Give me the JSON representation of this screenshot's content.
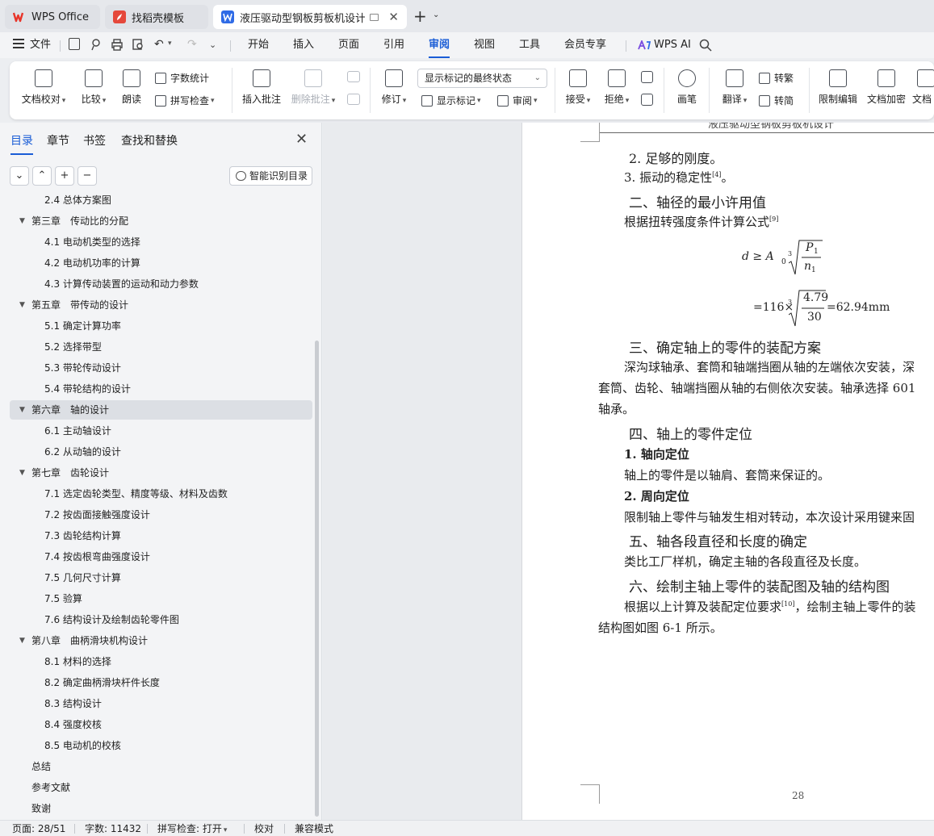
{
  "tabs": [
    {
      "label": "WPS Office",
      "active": false
    },
    {
      "label": "找稻壳模板",
      "active": false
    },
    {
      "label": "液压驱动型钢板剪板机设计 说",
      "active": true
    }
  ],
  "menu": {
    "file": "文件",
    "items": [
      "开始",
      "插入",
      "页面",
      "引用",
      "审阅",
      "视图",
      "工具",
      "会员专享"
    ],
    "active": "审阅",
    "ai": "WPS AI"
  },
  "ribbon": {
    "doc_proof": "文档校对",
    "compare": "比较",
    "read_aloud": "朗读",
    "word_count": "字数统计",
    "spell_check": "拼写检查",
    "insert_comment": "插入批注",
    "delete_comment": "删除批注",
    "revise": "修订",
    "markup_state": "显示标记的最终状态",
    "show_markup": "显示标记",
    "review": "审阅",
    "accept": "接受",
    "reject": "拒绝",
    "pen": "画笔",
    "translate": "翻译",
    "to_traditional": "转繁",
    "to_simplified": "转简",
    "restrict_edit": "限制编辑",
    "encrypt": "文档加密",
    "doc_more": "文档"
  },
  "nav": {
    "tabs": [
      "目录",
      "章节",
      "书签",
      "查找和替换"
    ],
    "active_tab": "目录",
    "smart_toc": "智能识别目录",
    "items": [
      {
        "text": "2.4 总体方案图",
        "level": 2
      },
      {
        "text": "第三章　传动比的分配",
        "level": 1,
        "expanded": true
      },
      {
        "text": "4.1 电动机类型的选择",
        "level": 2
      },
      {
        "text": "4.2 电动机功率的计算",
        "level": 2
      },
      {
        "text": "4.3 计算传动装置的运动和动力参数",
        "level": 2
      },
      {
        "text": "第五章　带传动的设计",
        "level": 1,
        "expanded": true
      },
      {
        "text": "5.1 确定计算功率",
        "level": 2
      },
      {
        "text": "5.2 选择带型",
        "level": 2
      },
      {
        "text": "5.3 带轮传动设计",
        "level": 2
      },
      {
        "text": "5.4 带轮结构的设计",
        "level": 2
      },
      {
        "text": "第六章　轴的设计",
        "level": 1,
        "expanded": true,
        "selected": true
      },
      {
        "text": "6.1 主动轴设计",
        "level": 2
      },
      {
        "text": "6.2 从动轴的设计",
        "level": 2
      },
      {
        "text": "第七章　齿轮设计",
        "level": 1,
        "expanded": true
      },
      {
        "text": "7.1 选定齿轮类型、精度等级、材料及齿数",
        "level": 2
      },
      {
        "text": "7.2 按齿面接触强度设计",
        "level": 2
      },
      {
        "text": "7.3 齿轮结构计算",
        "level": 2
      },
      {
        "text": "7.4 按齿根弯曲强度设计",
        "level": 2
      },
      {
        "text": "7.5 几何尺寸计算",
        "level": 2
      },
      {
        "text": "7.5 验算",
        "level": 2
      },
      {
        "text": "7.6 结构设计及绘制齿轮零件图",
        "level": 2
      },
      {
        "text": "第八章　曲柄滑块机构设计",
        "level": 1,
        "expanded": true
      },
      {
        "text": "8.1 材料的选择",
        "level": 2
      },
      {
        "text": "8.2 确定曲柄滑块杆件长度",
        "level": 2
      },
      {
        "text": "8.3 结构设计",
        "level": 2
      },
      {
        "text": "8.4 强度校核",
        "level": 2
      },
      {
        "text": "8.5 电动机的校核",
        "level": 2
      },
      {
        "text": "总结",
        "level": 1,
        "expanded": false
      },
      {
        "text": "参考文献",
        "level": 1,
        "expanded": false
      },
      {
        "text": "致谢",
        "level": 1,
        "expanded": false
      }
    ]
  },
  "doc": {
    "running_header": "液压驱动型钢板剪板机设计",
    "l1": "2. 足够的刚度。",
    "l2": "3. 振动的稳定性",
    "l2_ref": "[4]",
    "l2_end": "。",
    "h2": "二、轴径的最小许用值",
    "l3": "根据扭转强度条件计算公式",
    "l3_ref": "[9]",
    "formula1_lhs": "d ≥ A",
    "formula1_sub": "0",
    "formula1_num": "P",
    "formula1_num_sub": "1",
    "formula1_den": "n",
    "formula1_den_sub": "1",
    "formula2_lhs": "=116×",
    "formula2_num": "4.79",
    "formula2_den": "30",
    "formula2_rhs": "=62.94mm",
    "h3": "三、确定轴上的零件的装配方案",
    "p3a": "深沟球轴承、套筒和轴端挡圈从轴的左端依次安装，深",
    "p3b": "套筒、齿轮、轴端挡圈从轴的右侧依次安装。轴承选择 601",
    "p3c": "轴承。",
    "h4": "四、轴上的零件定位",
    "s1": "1. 轴向定位",
    "p4a": "轴上的零件是以轴肩、套筒来保证的。",
    "s2": "2. 周向定位",
    "p4b": "限制轴上零件与轴发生相对转动，本次设计采用键来固",
    "h5": "五、轴各段直径和长度的确定",
    "p5": "类比工厂样机，确定主轴的各段直径及长度。",
    "h6": "六、绘制主轴上零件的装配图及轴的结构图",
    "p6a": "根据以上计算及装配定位要求",
    "p6_ref": "[10]",
    "p6a_end": "，绘制主轴上零件的装",
    "p6b": "结构图如图 6-1 所示。",
    "page_number": "28"
  },
  "status": {
    "page": "页面: 28/51",
    "words": "字数: 11432",
    "spell": "拼写检查: 打开",
    "proof": "校对",
    "compat": "兼容模式"
  },
  "colors": {
    "accent": "#1a5dd6",
    "wps_red": "#e8352a",
    "docer_red": "#e5483b",
    "writer_blue": "#2f6be6"
  }
}
